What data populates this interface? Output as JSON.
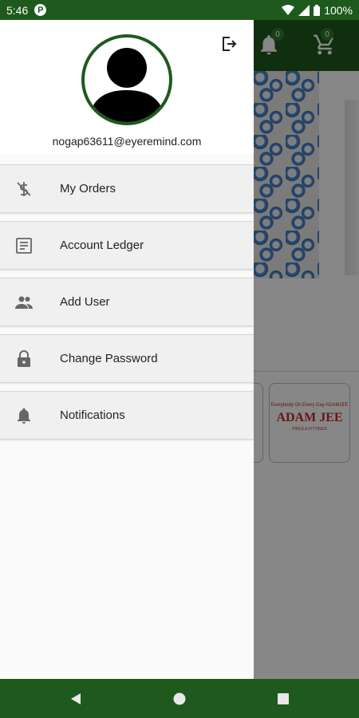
{
  "status_bar": {
    "time": "5:46",
    "app_badge": "P",
    "battery": "100%"
  },
  "app": {
    "notification_count": "0",
    "cart_count": "0",
    "brand_name": "ADAM JEE",
    "brand_tagline": "Everybody On Every Day ADAMJEE",
    "brand_sub": "PIPES & FITTINGS"
  },
  "drawer": {
    "email": "nogap63611@eyeremind.com",
    "menu": [
      {
        "label": "My Orders",
        "icon": "dollar-off-icon"
      },
      {
        "label": "Account Ledger",
        "icon": "ledger-icon"
      },
      {
        "label": "Add User",
        "icon": "people-icon"
      },
      {
        "label": "Change Password",
        "icon": "lock-icon"
      },
      {
        "label": "Notifications",
        "icon": "bell-icon"
      }
    ]
  },
  "colors": {
    "primary": "#1e5a1e",
    "accent": "#2e7d32",
    "brand_red": "#c62828"
  }
}
